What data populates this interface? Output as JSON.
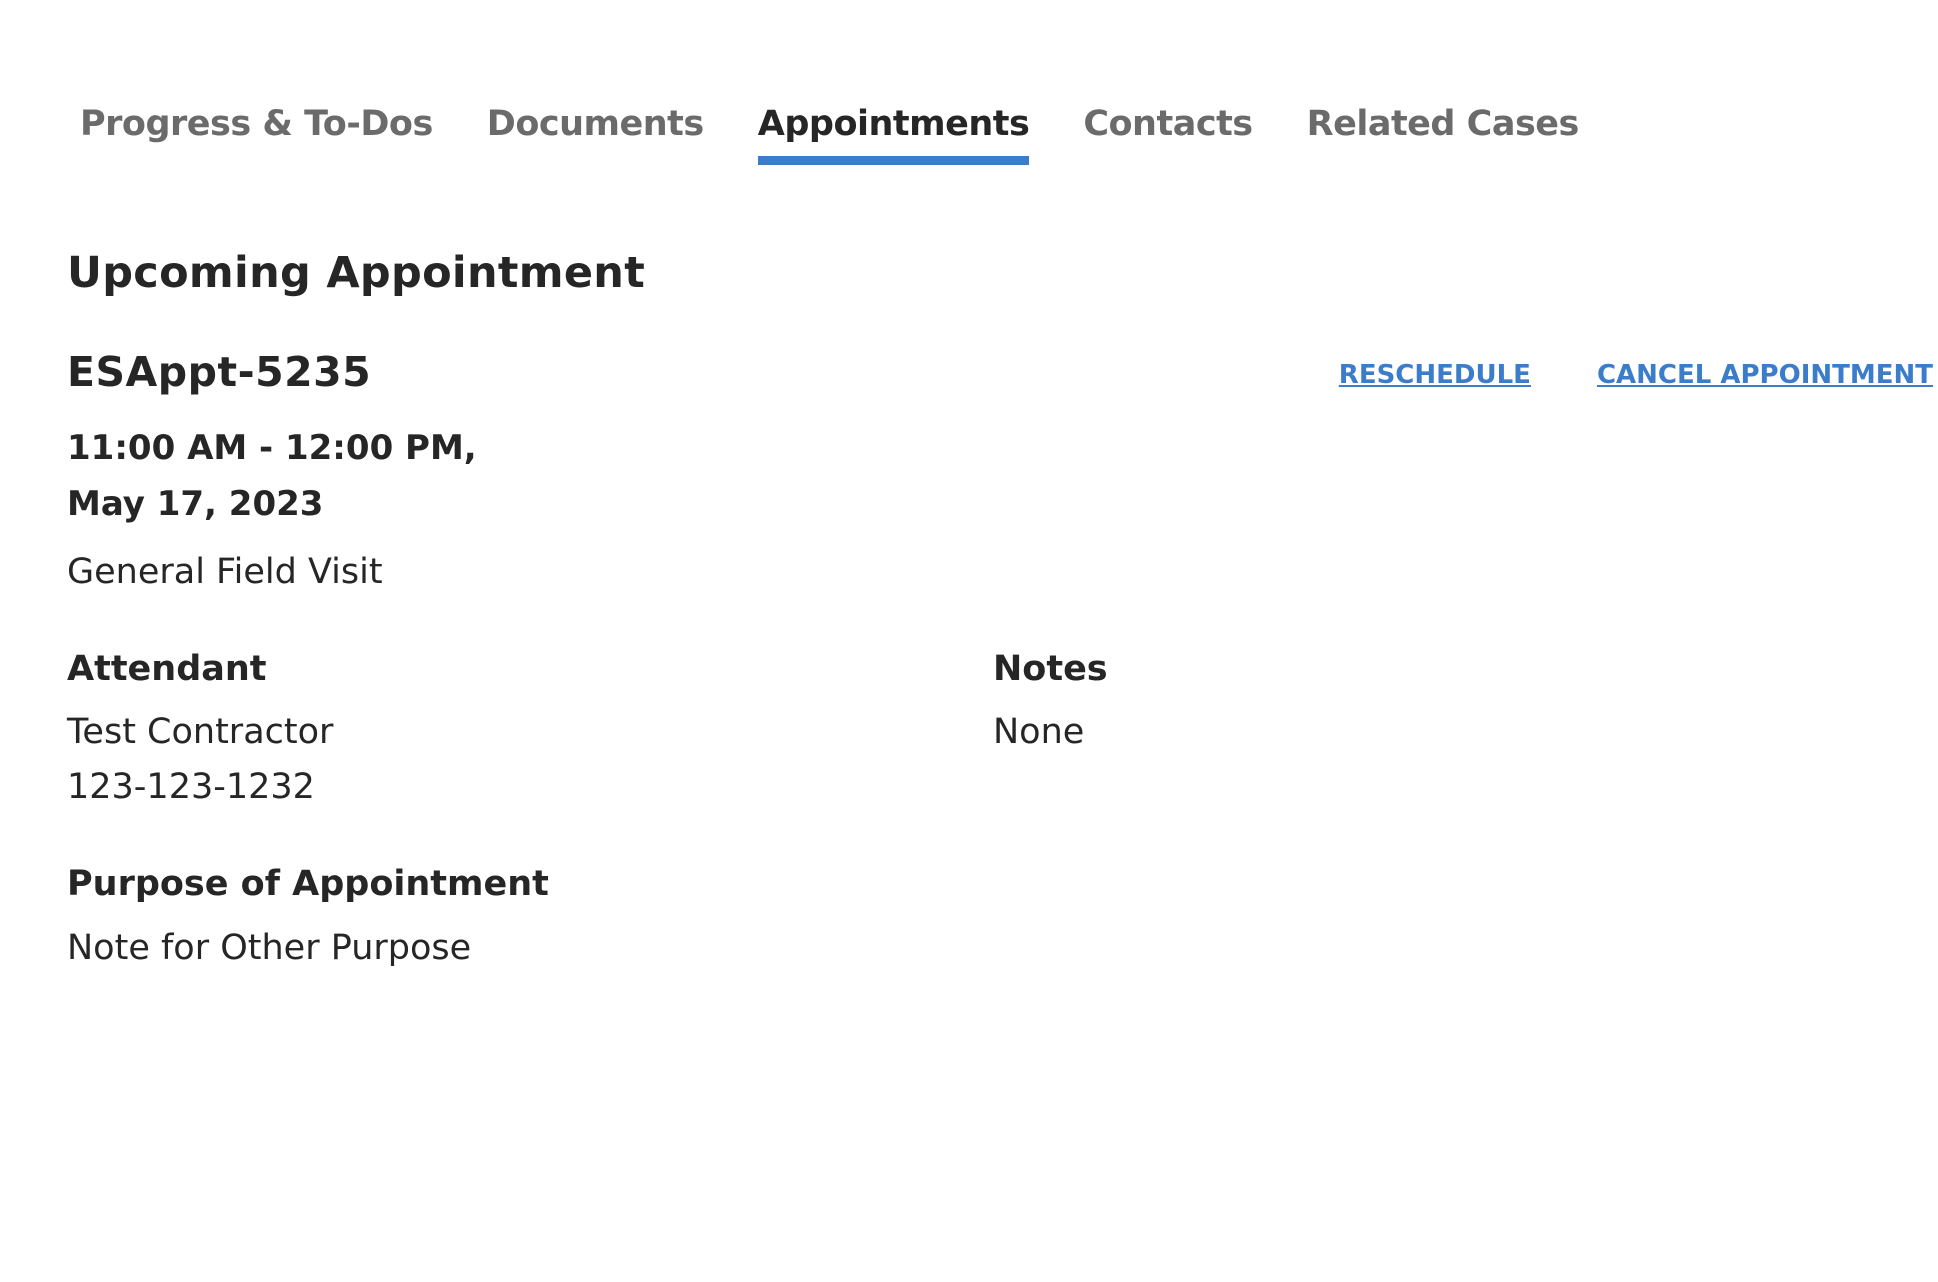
{
  "tabs": [
    {
      "label": "Progress & To-Dos",
      "active": false
    },
    {
      "label": "Documents",
      "active": false
    },
    {
      "label": "Appointments",
      "active": true
    },
    {
      "label": "Contacts",
      "active": false
    },
    {
      "label": "Related Cases",
      "active": false
    }
  ],
  "section": {
    "heading": "Upcoming Appointment"
  },
  "appointment": {
    "id": "ESAppt-5235",
    "time": "11:00 AM - 12:00 PM,",
    "date": "May 17, 2023",
    "type": "General Field Visit",
    "attendant_label": "Attendant",
    "attendant_name": "Test Contractor",
    "attendant_phone": "123-123-1232",
    "notes_label": "Notes",
    "notes_value": "None",
    "purpose_label": "Purpose of Appointment",
    "purpose_value": "Note for Other Purpose"
  },
  "actions": {
    "reschedule_label": "RESCHEDULE",
    "cancel_label": "CANCEL APPOINTMENT"
  },
  "colors": {
    "accent": "#3b7ccb",
    "text": "#262626",
    "tab_inactive": "#6b6b6b"
  }
}
